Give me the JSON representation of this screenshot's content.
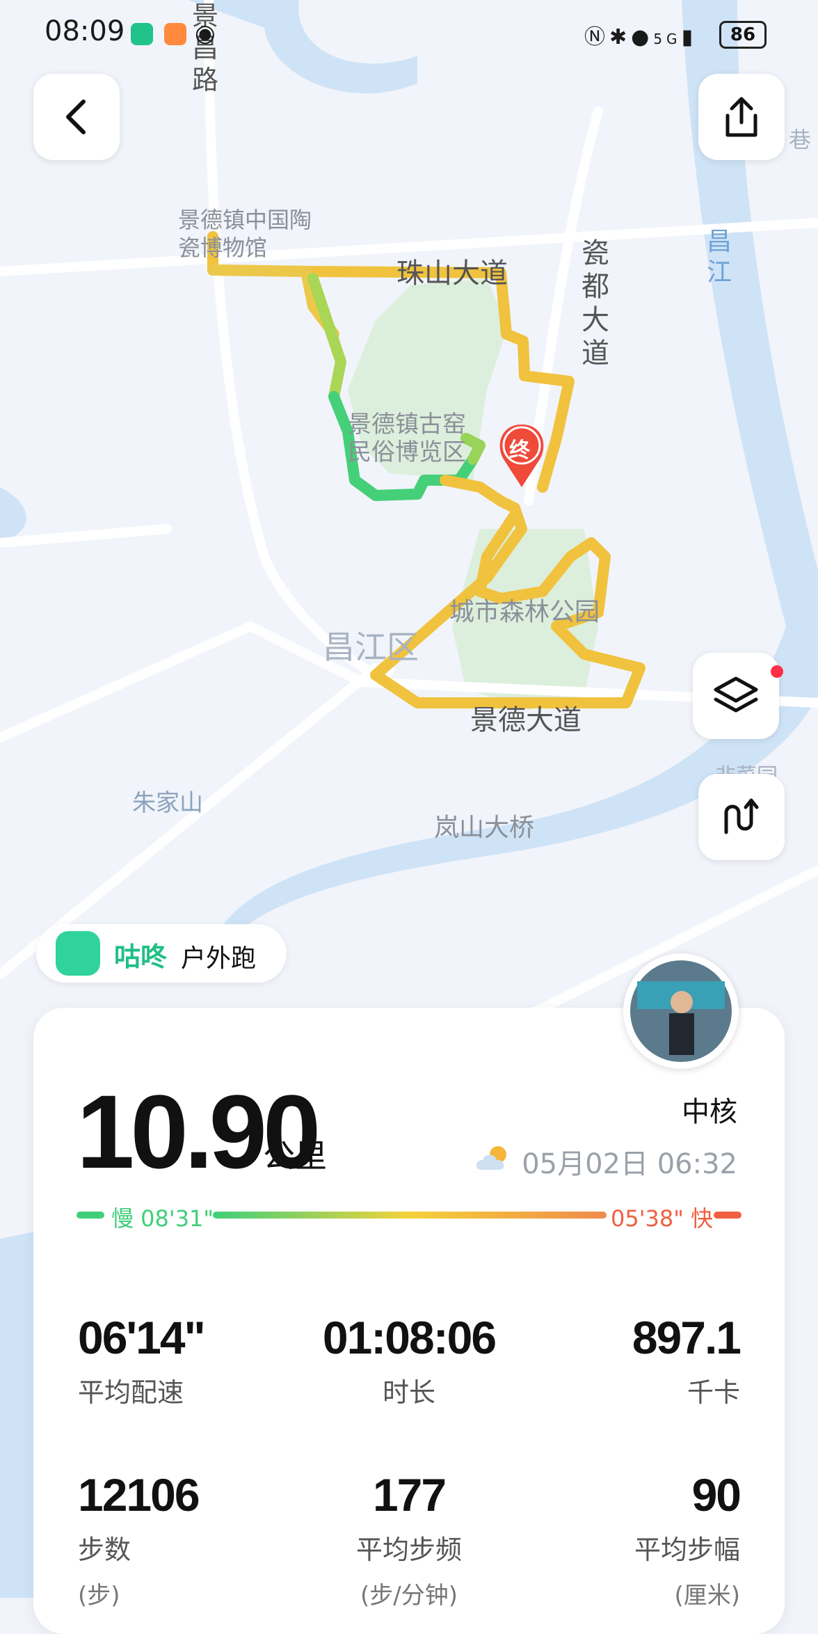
{
  "status_bar": {
    "time": "08:09",
    "battery": "86",
    "network": "5G"
  },
  "map": {
    "roads": [
      "珠山大道",
      "瓷都大道",
      "景德大道",
      "景昌路"
    ],
    "places": [
      "景德镇中国陶瓷博物馆",
      "景德镇古窑民俗博览区",
      "城市森林公园",
      "昌江区",
      "朱家山",
      "岚山大桥",
      "昌江",
      "巷",
      "非菜园"
    ],
    "end_marker": "终",
    "colors": {
      "slow": "#3fcf7a",
      "mid": "#f4d23a",
      "fast": "#f07a4a",
      "water": "#cfe3f7",
      "park": "#dcefdc"
    }
  },
  "buttons": {
    "back_icon": "chevron-left-icon",
    "share_icon": "share-icon",
    "layers_icon": "layers-icon",
    "route_icon": "route-icon"
  },
  "app": {
    "name": "咕咚",
    "activity": "户外跑"
  },
  "summary": {
    "distance": "10.90",
    "distance_unit": "公里",
    "user": "中核",
    "datetime": "05月02日 06:32",
    "pace_slow": "慢 08'31\"",
    "pace_fast": "05'38\" 快"
  },
  "stats": [
    {
      "value": "06'14\"",
      "label": "平均配速",
      "unit": ""
    },
    {
      "value": "01:08:06",
      "label": "时长",
      "unit": ""
    },
    {
      "value": "897.1",
      "label": "千卡",
      "unit": ""
    },
    {
      "value": "12106",
      "label": "步数",
      "unit": "(步)"
    },
    {
      "value": "177",
      "label": "平均步频",
      "unit": "(步/分钟)"
    },
    {
      "value": "90",
      "label": "平均步幅",
      "unit": "(厘米)"
    }
  ]
}
